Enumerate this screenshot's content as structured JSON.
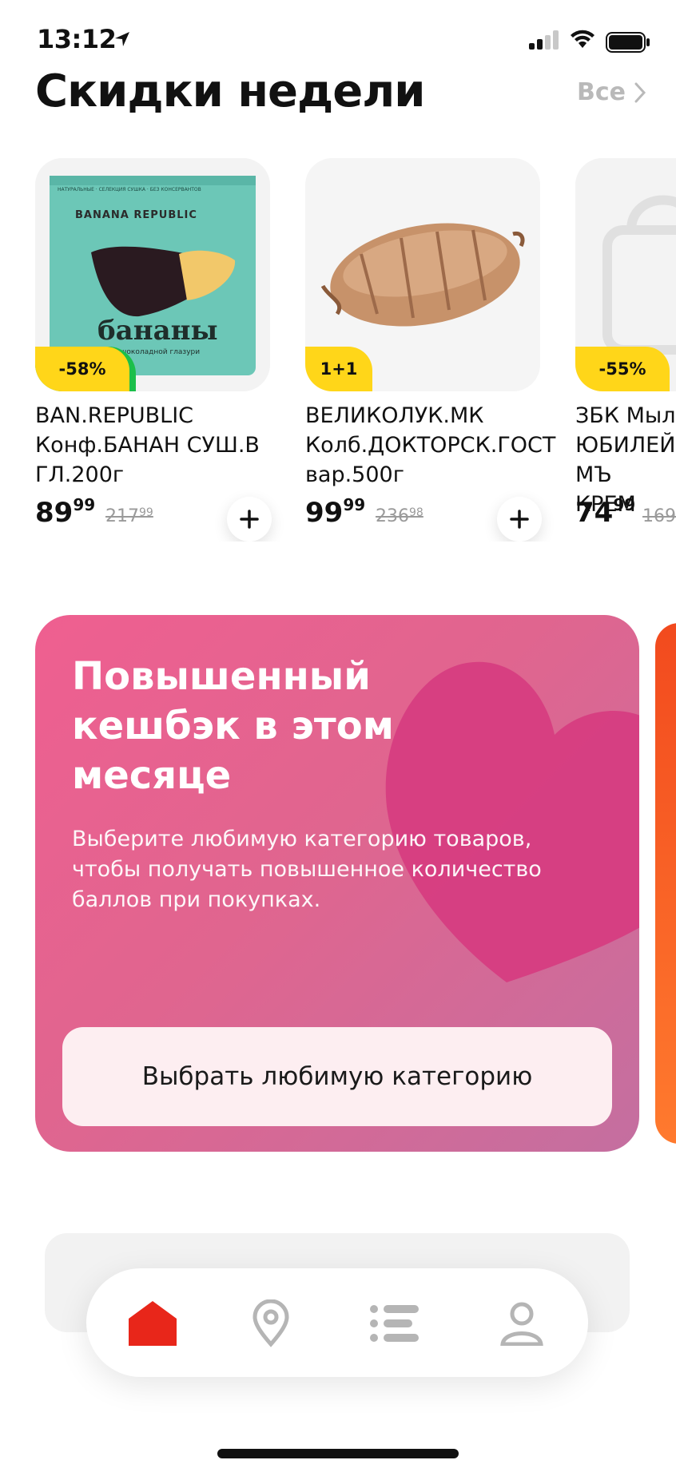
{
  "status_bar": {
    "time": "13:12"
  },
  "section": {
    "title": "Скидки недели",
    "see_all": "Все"
  },
  "products": [
    {
      "badge": "-58%",
      "name": "BAN.REPUBLIC Конф.БАНАН СУШ.В ГЛ.200г",
      "price_int": "89",
      "price_cents": "99",
      "old_int": "217",
      "old_cents": "99"
    },
    {
      "badge": "1+1",
      "name": "ВЕЛИКОЛУК.МК Колб.ДОКТОРСК.ГОСТ вар.500г",
      "price_int": "99",
      "price_cents": "99",
      "old_int": "236",
      "old_cents": "98"
    },
    {
      "badge": "-55%",
      "name": "ЗБК Мыл ЮБИЛЕЙ МЪ КРЕМ",
      "price_int": "74",
      "price_cents": "99",
      "old_int": "169",
      "old_cents": ""
    }
  ],
  "banana_pack": {
    "brand": "BANANA REPUBLIC",
    "label": "бананы",
    "sub": "в шоколадной глазури",
    "top": "НАТУРАЛЬНЫЕ · СЕЛЕКЦИЯ СУШКА · БЕЗ КОНСЕРВАНТОВ"
  },
  "promo": {
    "title": "Повышенный кешбэк в этом месяце",
    "text": "Выберите любимую категорию товаров, чтобы получать повышенное количество баллов при покупках.",
    "button": "Выбрать любимую категорию"
  },
  "tabbar": {
    "tabs": [
      "home-icon",
      "location-pin-icon",
      "catalog-list-icon",
      "profile-icon"
    ],
    "active": 0,
    "active_color": "#e8261a",
    "inactive_color": "#b5b5b5"
  }
}
